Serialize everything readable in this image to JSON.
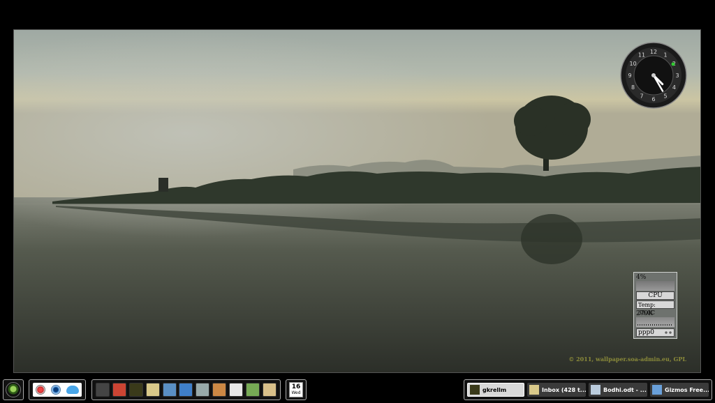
{
  "wallpaper": {
    "credit": "© 2011, wallpaper.soa-admin.eu, GPL"
  },
  "clock": {
    "numerals": [
      "12",
      "1",
      "2",
      "3",
      "4",
      "5",
      "6",
      "7",
      "8",
      "9",
      "10",
      "11"
    ],
    "hour_angle_deg": 135,
    "minute_angle_deg": 150
  },
  "cpu_monitor": {
    "cpu_percent": "4%",
    "cpu_label": "CPU",
    "temperature": "Temp: 38.0C",
    "net_rate": "279K",
    "interface": "ppp0"
  },
  "taskbar": {
    "menu_icon": "menu-orb-icon",
    "launchers": [
      {
        "name": "compass-icon"
      },
      {
        "name": "eye-icon"
      },
      {
        "name": "bird-icon"
      }
    ],
    "apps": [
      {
        "name": "terminal-icon"
      },
      {
        "name": "radiation-icon"
      },
      {
        "name": "monitor-icon"
      },
      {
        "name": "notes-icon"
      },
      {
        "name": "disc-icon"
      },
      {
        "name": "network-icon"
      },
      {
        "name": "drive-icon"
      },
      {
        "name": "download-icon"
      },
      {
        "name": "cards-icon"
      },
      {
        "name": "chart-icon"
      },
      {
        "name": "mahjong-icon"
      }
    ],
    "calendar": {
      "day": "16",
      "weekday": "Wed"
    },
    "tasks": [
      {
        "label": "gkrellm",
        "active": true
      },
      {
        "label": "Inbox (428 t...",
        "active": false
      },
      {
        "label": "Bodhi.odt - ...",
        "active": false
      },
      {
        "label": "Gizmos Free...",
        "active": false
      }
    ]
  },
  "colors": {
    "taskbar_bg": "#000000",
    "shelf_border": "#aaaaaa",
    "active_task_bg": "#d8d8d8",
    "inactive_task_bg": "#3a3a3a",
    "credit_text": "#8a8a3a"
  }
}
